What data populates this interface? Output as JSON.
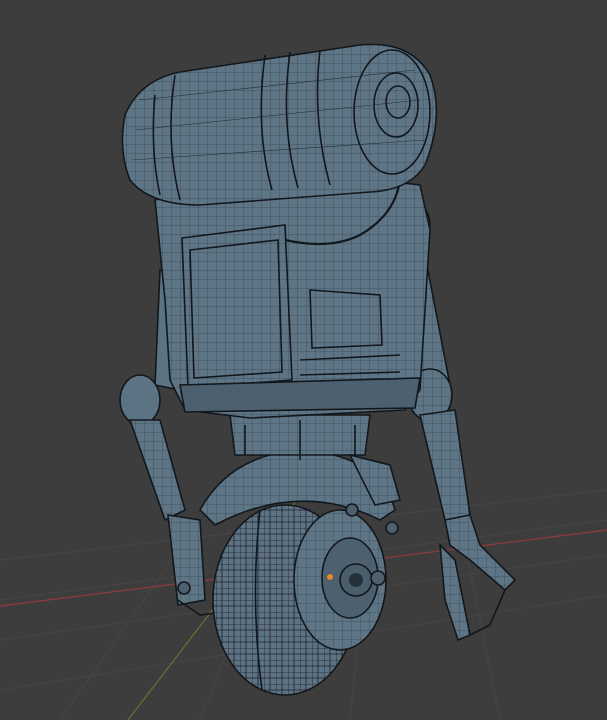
{
  "viewport": {
    "mode": "wireframe-overlay",
    "background": "#3d3d3d",
    "grid_color": "#474747",
    "x_axis_color": "#8a3a3f",
    "y_axis_color": "#5a7a2e",
    "mesh_color": "#5c7384",
    "wire_color": "#1b222a"
  },
  "model": {
    "name": "",
    "origin_color": "#e88a2a"
  }
}
